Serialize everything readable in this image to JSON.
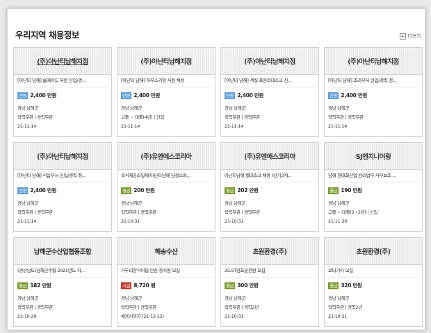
{
  "title": "우리지역 채용정보",
  "more_label": "더보기",
  "badge_colors": {
    "연봉": "#5b9bd5",
    "월급": "#7a9a2e",
    "시급": "#c0392b"
  },
  "cards": [
    {
      "company": "(주)아난티남해지점",
      "underline": true,
      "job": "[아난티 남해] 룸메이드 부문 신입/경...",
      "pay_type": "연봉",
      "pay": "2,400 만원",
      "location": "경남 남해군",
      "requirements": "학력무관 | 경력무관",
      "extra": "",
      "date": "21-11-14"
    },
    {
      "company": "(주)아난티남해지점",
      "underline": false,
      "job": "[아난티 남해] 하우스키핑 사원 채용",
      "pay_type": "연봉",
      "pay": "2,400 만원",
      "location": "경남 남해군",
      "requirements": "고졸 ~ 대졸(4년) | 신입",
      "extra": "",
      "date": "21-11-14"
    },
    {
      "company": "(주)아난티남해지점",
      "underline": false,
      "job": "[아난티 남해] 객실 프론트데스크 신...",
      "pay_type": "연봉",
      "pay": "2,400 만원",
      "location": "경남 남해군",
      "requirements": "학력무관 | 경력무관",
      "extra": "",
      "date": "21-11-14"
    },
    {
      "company": "(주)아난티남해지점",
      "underline": false,
      "job": "[아난티 남해] 조리부서 신입/경력 정...",
      "pay_type": "연봉",
      "pay": "2,400 만원",
      "location": "경남 남해군",
      "requirements": "학력무관 | 경력무관",
      "extra": "",
      "date": "21-11-14"
    },
    {
      "company": "(주)아난티남해지점",
      "underline": false,
      "job": "[아난티 남해] 식음부서 신입/경력 정...",
      "pay_type": "연봉",
      "pay": "2,400 만원",
      "location": "경남 남해군",
      "requirements": "학력무관 | 경력무관",
      "extra": "",
      "date": "21-11-14"
    },
    {
      "company": "(주)유엔에스코리아",
      "underline": false,
      "job": "숙식제공/5일제/아난티남해 남성스파...",
      "pay_type": "월급",
      "pay": "200 만원",
      "location": "경남 남해군",
      "requirements": "학력무관 | 경력무관",
      "extra": "",
      "date": "21-10-31"
    },
    {
      "company": "(주)유엔에스코리아",
      "underline": false,
      "job": "아난티남해 벨데스크 채용 (단기3개...",
      "pay_type": "월급",
      "pay": "202 만원",
      "location": "경남 남해군",
      "requirements": "학력무관 | 경력무관",
      "extra": "",
      "date": "21-10-31"
    },
    {
      "company": "SJ엔지니어링",
      "underline": false,
      "job": "남해 현대화산업 감리업무 사무보조 ...",
      "pay_type": "월급",
      "pay": "190 만원",
      "location": "경남 남해군",
      "requirements": "고졸 ~ 대졸(2~3년) | 신입",
      "extra": "",
      "date": "21-11-30"
    },
    {
      "company": "남해군수산업협동조합",
      "underline": false,
      "job": "(경상남도)남해군수협 2021년도 하...",
      "pay_type": "월급",
      "pay": "182 만원",
      "location": "경남 남해군",
      "requirements": "학력무관 | 경력무관",
      "extra": "",
      "date": "21-10-29"
    },
    {
      "company": "혜송수산",
      "underline": false,
      "job": "가두리양식어업 단순 종사원 모집",
      "pay_type": "시급",
      "pay": "8,720 원",
      "location": "경남 남해군",
      "requirements": "학력무관 | 경력무관",
      "extra": "채용시까지 (21-12-12)",
      "date": ""
    },
    {
      "company": "초원환경(주)",
      "underline": false,
      "job": "25.5T덤프운전원 모집",
      "pay_type": "월급",
      "pay": "300 만원",
      "location": "경남 남해군",
      "requirements": "학력무관 | 경력2년",
      "extra": "",
      "date": "21-10-31"
    },
    {
      "company": "초원환경(주)",
      "underline": false,
      "job": "로더기사 모집",
      "pay_type": "월급",
      "pay": "320 만원",
      "location": "경남 남해군",
      "requirements": "학력무관 | 경력2년",
      "extra": "",
      "date": "21-10-31"
    }
  ]
}
